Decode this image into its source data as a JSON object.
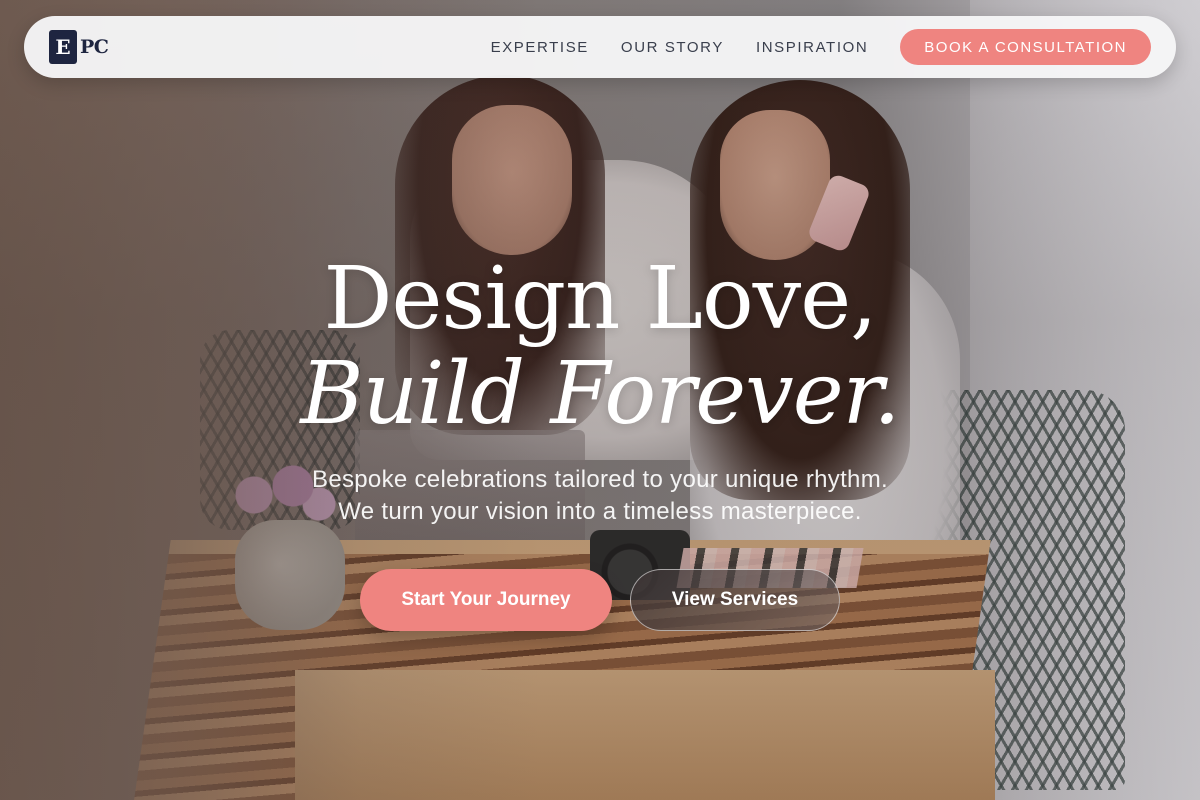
{
  "nav": {
    "logo": {
      "mark": "E",
      "text": "PC"
    },
    "links": [
      "EXPERTISE",
      "OUR STORY",
      "INSPIRATION"
    ],
    "cta_label": "BOOK A CONSULTATION"
  },
  "hero": {
    "headline_line1": "Design Love,",
    "headline_line2": "Build Forever.",
    "subtext_line1": "Bespoke celebrations tailored to your unique rhythm.",
    "subtext_line2": "We turn your vision into a timeless masterpiece.",
    "primary_button": "Start Your Journey",
    "secondary_button": "View Services"
  },
  "colors": {
    "accent": "#ef8480",
    "logo_navy": "#1e2540",
    "nav_text": "#3a3f4d"
  }
}
